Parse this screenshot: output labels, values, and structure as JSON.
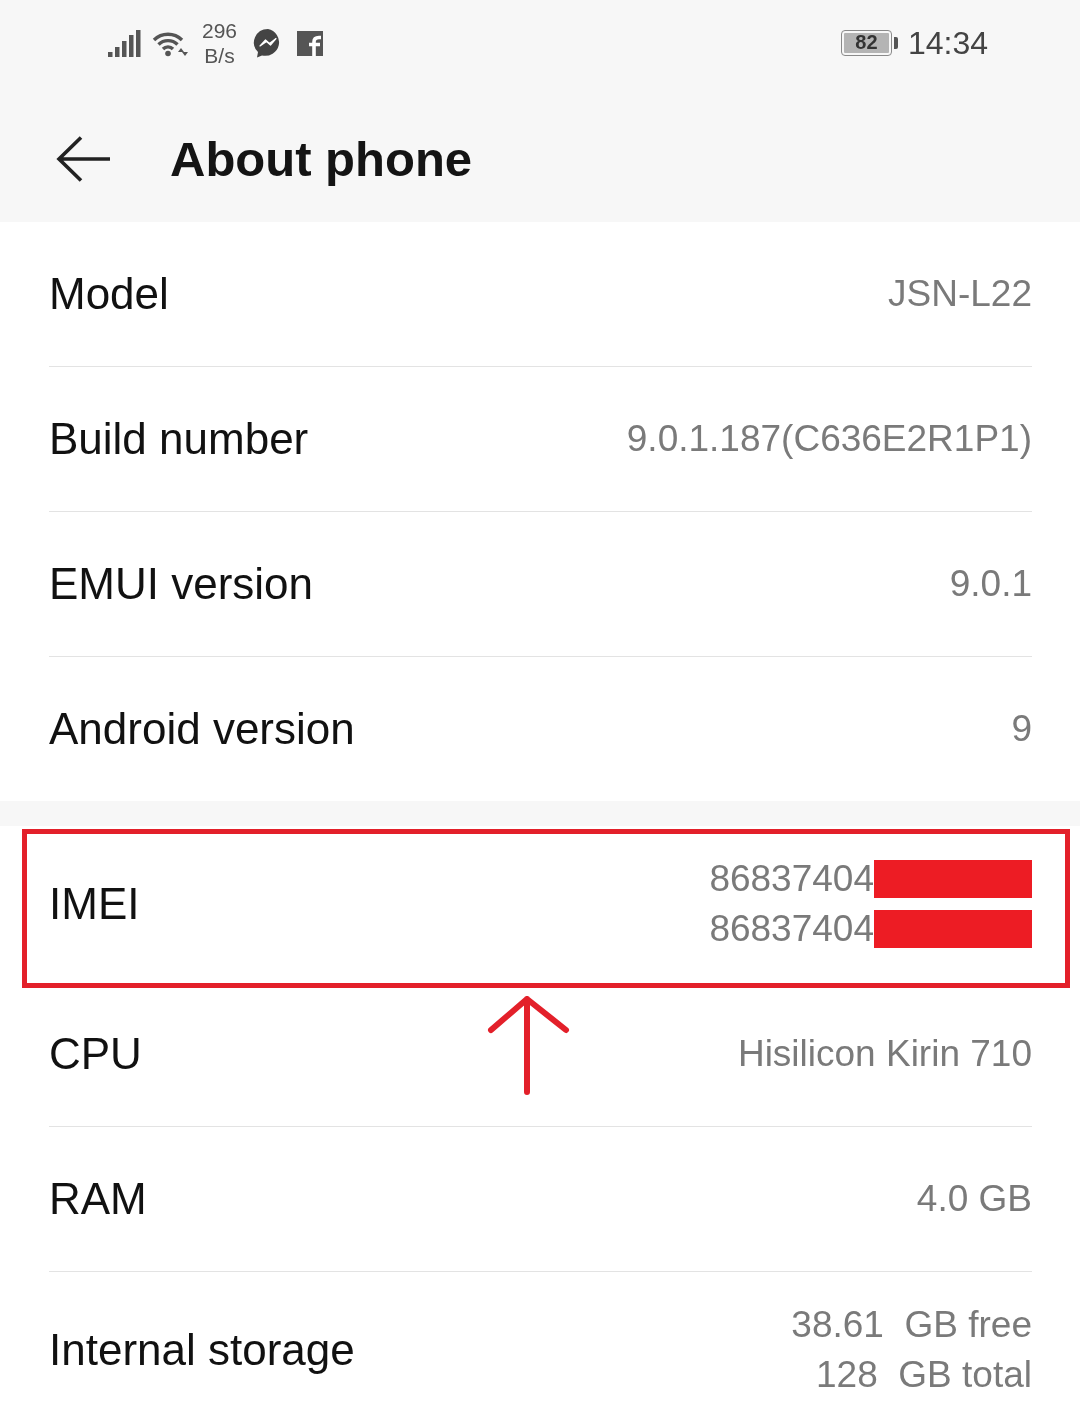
{
  "status_bar": {
    "network_speed": "296",
    "speed_unit": "B/s",
    "battery": "82",
    "time": "14:34"
  },
  "header": {
    "title": "About phone"
  },
  "sections": [
    {
      "rows": [
        {
          "label": "Model",
          "values": [
            {
              "text": "JSN-L22",
              "redacted": false
            }
          ],
          "highlighted": false
        },
        {
          "label": "Build number",
          "values": [
            {
              "text": "9.0.1.187(C636E2R1P1)",
              "redacted": false
            }
          ],
          "highlighted": false
        },
        {
          "label": "EMUI version",
          "values": [
            {
              "text": "9.0.1",
              "redacted": false
            }
          ],
          "highlighted": false
        },
        {
          "label": "Android version",
          "values": [
            {
              "text": "9",
              "redacted": false
            }
          ],
          "highlighted": false
        }
      ]
    },
    {
      "rows": [
        {
          "label": "IMEI",
          "values": [
            {
              "text": "86837404",
              "redacted": true
            },
            {
              "text": "86837404",
              "redacted": true
            }
          ],
          "highlighted": true
        },
        {
          "label": "CPU",
          "values": [
            {
              "text": "Hisilicon Kirin 710",
              "redacted": false
            }
          ],
          "highlighted": false
        },
        {
          "label": "RAM",
          "values": [
            {
              "text": "4.0 GB",
              "redacted": false
            }
          ],
          "highlighted": false
        },
        {
          "label": "Internal storage",
          "values": [
            {
              "text": "38.61  GB free",
              "redacted": false
            },
            {
              "text": "128  GB total",
              "redacted": false
            }
          ],
          "highlighted": false
        }
      ]
    }
  ]
}
